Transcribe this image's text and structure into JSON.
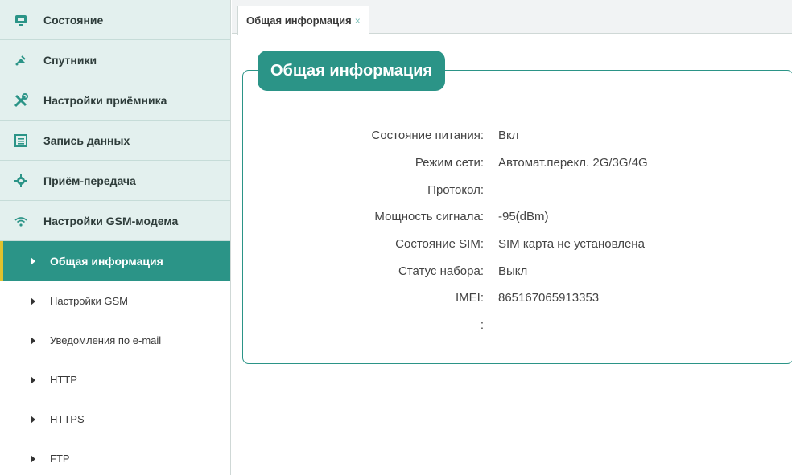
{
  "sidebar": {
    "menu": [
      {
        "label": "Состояние",
        "icon": "status-monitor-icon"
      },
      {
        "label": "Спутники",
        "icon": "satellite-icon"
      },
      {
        "label": "Настройки приёмника",
        "icon": "tools-icon"
      },
      {
        "label": "Запись данных",
        "icon": "data-log-icon"
      },
      {
        "label": "Приём-передача",
        "icon": "gear-icon"
      },
      {
        "label": "Настройки GSM-модема",
        "icon": "wifi-signal-icon"
      }
    ],
    "subitems": [
      {
        "label": "Общая информация",
        "active": true
      },
      {
        "label": "Настройки GSM"
      },
      {
        "label": "Уведомления по e-mail"
      },
      {
        "label": "HTTP"
      },
      {
        "label": "HTTPS"
      },
      {
        "label": "FTP"
      }
    ]
  },
  "tab": {
    "label": "Общая информация",
    "close": "×"
  },
  "panel": {
    "title": "Общая информация",
    "rows": [
      {
        "key": "Состояние питания:",
        "value": "Вкл"
      },
      {
        "key": "Режим сети:",
        "value": "Автомат.перекл. 2G/3G/4G"
      },
      {
        "key": "Протокол:",
        "value": ""
      },
      {
        "key": "Мощность сигнала:",
        "value": "-95(dBm)"
      },
      {
        "key": "Состояние SIM:",
        "value": "SIM карта не установлена"
      },
      {
        "key": "Статус набора:",
        "value": "Выкл"
      },
      {
        "key": "IMEI:",
        "value": "865167065913353"
      },
      {
        "key": ":",
        "value": ""
      }
    ]
  },
  "colors": {
    "accent": "#2b9487",
    "active_marker": "#e0c22e",
    "menu_bg": "#e3f0ee"
  }
}
